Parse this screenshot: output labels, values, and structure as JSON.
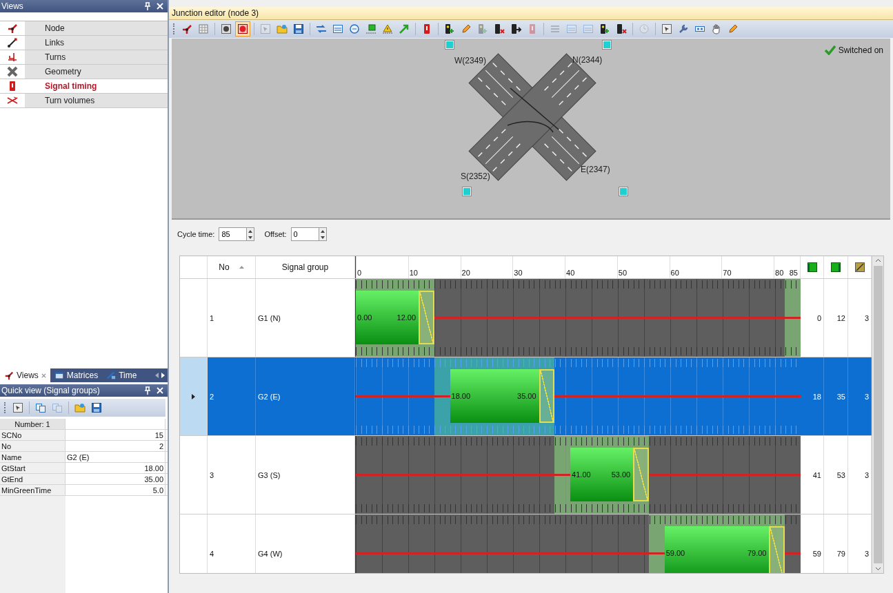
{
  "views_panel": {
    "title": "Views",
    "items": [
      {
        "label": "Node",
        "selected": false
      },
      {
        "label": "Links",
        "selected": false
      },
      {
        "label": "Turns",
        "selected": false
      },
      {
        "label": "Geometry",
        "selected": false
      },
      {
        "label": "Signal timing",
        "selected": true
      },
      {
        "label": "Turn volumes",
        "selected": false
      }
    ]
  },
  "bottom_tabs": [
    {
      "label": "Views",
      "selected": true
    },
    {
      "label": "Matrices",
      "selected": false
    },
    {
      "label": "Time",
      "selected": false
    }
  ],
  "quick_view": {
    "title": "Quick view (Signal groups)",
    "toolbar": [
      {
        "disabled": false
      },
      {
        "disabled": false
      },
      {
        "disabled": true
      },
      {
        "disabled": false
      },
      {
        "disabled": false
      }
    ],
    "header": "Number: 1",
    "rows": [
      {
        "name": "SCNo",
        "value": "15",
        "kind": "number"
      },
      {
        "name": "No",
        "value": "2",
        "kind": "number"
      },
      {
        "name": "Name",
        "value": "G2 (E)",
        "kind": "text"
      },
      {
        "name": "GtStart",
        "value": "18.00",
        "kind": "number"
      },
      {
        "name": "GtEnd",
        "value": "35.00",
        "kind": "number"
      },
      {
        "name": "MinGreenTime",
        "value": "5.0",
        "kind": "number"
      }
    ]
  },
  "editor": {
    "title": "Junction editor (node 3)",
    "toolbar": [
      {
        "selected": false,
        "disabled": false
      },
      {
        "selected": false,
        "disabled": false
      },
      {
        "selected": false,
        "disabled": false
      },
      {
        "selected": true,
        "disabled": false
      },
      {
        "selected": false,
        "disabled": true
      },
      {
        "selected": false,
        "disabled": false
      },
      {
        "selected": false,
        "disabled": false
      },
      {
        "selected": false,
        "disabled": false
      },
      {
        "selected": false,
        "disabled": false
      },
      {
        "selected": false,
        "disabled": false
      },
      {
        "selected": false,
        "disabled": false
      },
      {
        "selected": false,
        "disabled": false
      },
      {
        "selected": false,
        "disabled": false
      },
      {
        "selected": false,
        "disabled": false
      },
      {
        "selected": false,
        "disabled": false
      },
      {
        "selected": false,
        "disabled": false
      },
      {
        "selected": false,
        "disabled": true
      },
      {
        "selected": false,
        "disabled": false
      },
      {
        "selected": false,
        "disabled": false
      },
      {
        "selected": false,
        "disabled": true
      },
      {
        "selected": false,
        "disabled": true
      },
      {
        "selected": false,
        "disabled": true
      },
      {
        "selected": false,
        "disabled": true
      },
      {
        "selected": false,
        "disabled": false
      },
      {
        "selected": false,
        "disabled": false
      },
      {
        "selected": false,
        "disabled": true
      },
      {
        "selected": false,
        "disabled": false
      },
      {
        "selected": false,
        "disabled": false
      },
      {
        "selected": false,
        "disabled": false
      },
      {
        "selected": false,
        "disabled": false
      },
      {
        "selected": false,
        "disabled": false
      }
    ],
    "junction": {
      "legs": [
        {
          "label": "W(2349)"
        },
        {
          "label": "N(2344)"
        },
        {
          "label": "S(2352)"
        },
        {
          "label": "E(2347)"
        }
      ],
      "status": "Switched on"
    },
    "cycle_time": {
      "label": "Cycle time:",
      "value": "85"
    },
    "offset": {
      "label": "Offset:",
      "value": "0"
    },
    "table": {
      "columns": {
        "no": "No",
        "signal_group": "Signal group"
      },
      "timeline_ticks": [
        "0",
        "10",
        "20",
        "30",
        "40",
        "50",
        "60",
        "70",
        "80",
        "85"
      ],
      "rows": [
        {
          "no": "1",
          "name": "G1 (N)",
          "gt_start": "0.00",
          "gt_end": "12.00",
          "column_5": "0",
          "column_6": "12",
          "column_7": "3",
          "selected": false
        },
        {
          "no": "2",
          "name": "G2 (E)",
          "gt_start": "18.00",
          "gt_end": "35.00",
          "column_5": "18",
          "column_6": "35",
          "column_7": "3",
          "selected": true
        },
        {
          "no": "3",
          "name": "G3 (S)",
          "gt_start": "41.00",
          "gt_end": "53.00",
          "column_5": "41",
          "column_6": "53",
          "column_7": "3",
          "selected": false
        },
        {
          "no": "4",
          "name": "G4 (W)",
          "gt_start": "59.00",
          "gt_end": "79.00",
          "column_5": "59",
          "column_6": "79",
          "column_7": "3",
          "selected": false
        }
      ]
    }
  }
}
